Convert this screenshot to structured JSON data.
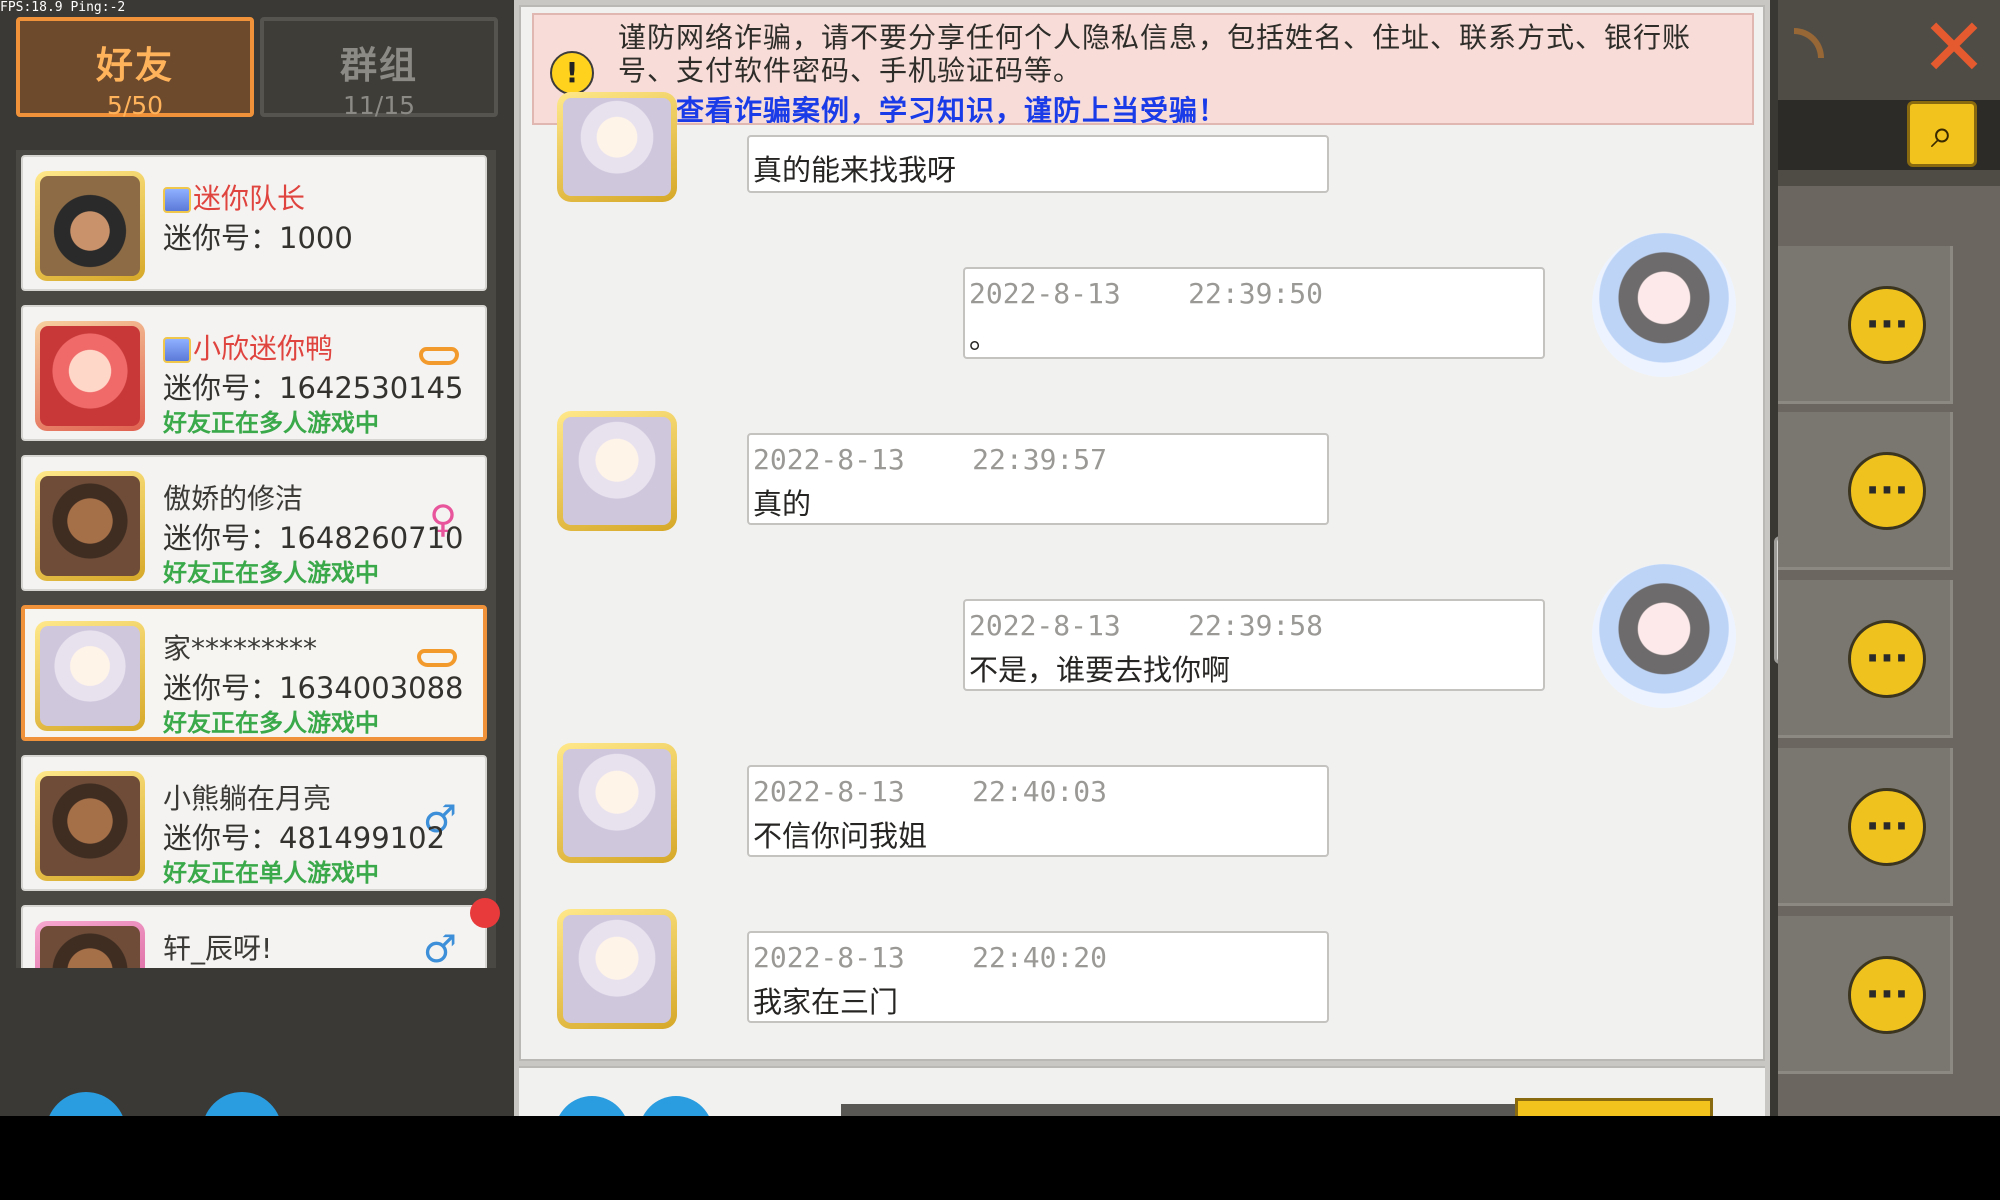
{
  "debug": {
    "fps_text": "FPS:18.9  Ping:-2"
  },
  "tabs": [
    {
      "label": "好友",
      "count": "5/50"
    },
    {
      "label": "群组",
      "count": "11/15"
    }
  ],
  "friends": [
    {
      "name": "迷你队长",
      "id": "迷你号：1000",
      "status": "",
      "vip": true
    },
    {
      "name": "小欣迷你鸭",
      "id": "迷你号：1642530145",
      "status": "好友正在多人游戏中",
      "vip": true
    },
    {
      "name": "傲娇的修洁",
      "id": "迷你号：1648260710",
      "status": "好友正在多人游戏中",
      "gender": "♀"
    },
    {
      "name": "家*********",
      "id": "迷你号：1634003088",
      "status": "好友正在多人游戏中",
      "selected": true
    },
    {
      "name": "小熊躺在月亮",
      "id": "迷你号：481499102",
      "status": "好友正在单人游戏中",
      "gender": "♂"
    },
    {
      "name": "轩_辰呀!",
      "id": "",
      "status": "",
      "gender": "♂"
    }
  ],
  "warning": {
    "text": "谨防网络诈骗，请不要分享任何个人隐私信息，包括姓名、住址、联系方式、银行账号、支付软件密码、手机验证码等。",
    "link": "点击查看诈骗案例，学习知识，谨防上当受骗！"
  },
  "messages": [
    {
      "side": "left",
      "time": "",
      "text": "真的能来找我呀"
    },
    {
      "side": "right",
      "time": "2022-8-13    22:39:50",
      "text": "。"
    },
    {
      "side": "left",
      "time": "2022-8-13    22:39:57",
      "text": "真的"
    },
    {
      "side": "right",
      "time": "2022-8-13    22:39:58",
      "text": "不是，谁要去找你啊"
    },
    {
      "side": "left",
      "time": "2022-8-13    22:40:03",
      "text": "不信你问我姐"
    },
    {
      "side": "left",
      "time": "2022-8-13    22:40:20",
      "text": "我家在三门"
    }
  ],
  "icons": {
    "close": "close-icon",
    "search": "search-icon",
    "chat": "chat-bubble-icon",
    "collapse": "arrow-left-icon",
    "warning": "warning-icon",
    "rss": "signal-icon"
  },
  "colors": {
    "accent_orange": "#f0923a",
    "vip_name": "#e0443f",
    "status_green": "#3aa94a",
    "link_blue": "#1a3ce8"
  }
}
